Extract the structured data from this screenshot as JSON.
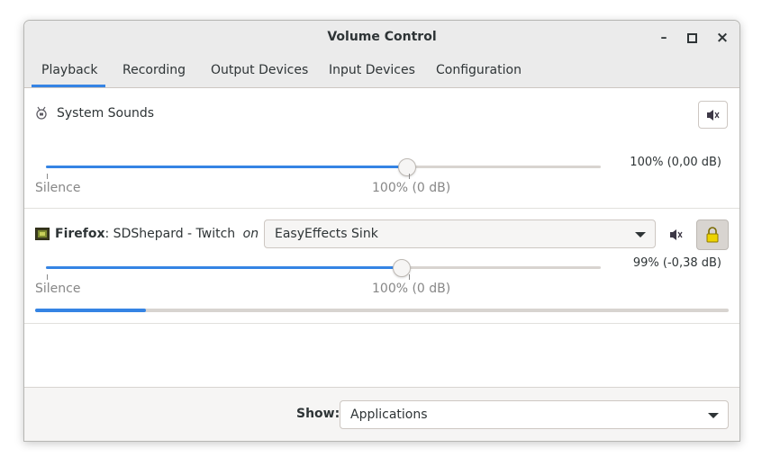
{
  "window": {
    "title": "Volume Control"
  },
  "window_controls": {
    "minimize": "–",
    "maximize": "□",
    "close": "×"
  },
  "tabs": [
    {
      "label": "Playback",
      "selected": true
    },
    {
      "label": "Recording"
    },
    {
      "label": "Output Devices"
    },
    {
      "label": "Input Devices"
    },
    {
      "label": "Configuration"
    }
  ],
  "streams": {
    "system": {
      "name": "System Sounds",
      "icon": "bell-icon",
      "volume_text": "100% (0,00 dB)",
      "volume_fraction": 0.65,
      "scale_min_label": "Silence",
      "scale_mark_label": "100% (0 dB)",
      "mute_icon": "speaker-icon"
    },
    "firefox": {
      "app": "Firefox",
      "title": ": SDShepard - Twitch",
      "on": "on",
      "icon": "firefox-icon",
      "device": "EasyEffects Sink",
      "volume_text": "99% (-0,38 dB)",
      "volume_fraction": 0.64,
      "scale_min_label": "Silence",
      "scale_mark_label": "100% (0 dB)",
      "peak_fraction": 0.16,
      "mute_icon": "speaker-icon",
      "lock_icon": "lock-icon"
    }
  },
  "footer": {
    "show_label": "Show:",
    "show_value": "Applications"
  },
  "colors": {
    "accent": "#3584e4"
  }
}
